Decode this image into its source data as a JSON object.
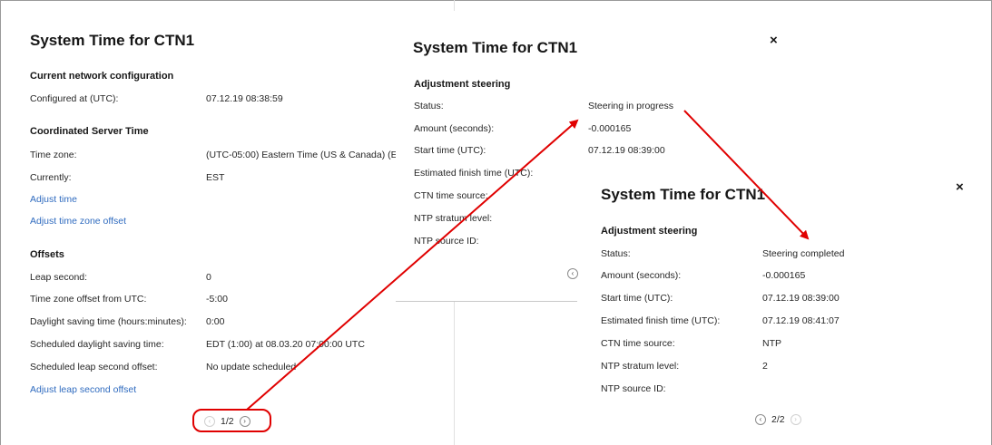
{
  "panel1": {
    "title": "System Time for CTN1",
    "section_network": "Current network configuration",
    "configured_label": "Configured at (UTC):",
    "configured_value": "07.12.19 08:38:59",
    "section_cst": "Coordinated Server Time",
    "timezone_label": "Time zone:",
    "timezone_value": "(UTC-05:00) Eastern Time (US & Canada) (E",
    "currently_label": "Currently:",
    "currently_value": "EST",
    "link_adjust_time": "Adjust time",
    "link_adjust_tz": "Adjust time zone offset",
    "section_offsets": "Offsets",
    "leap_label": "Leap second:",
    "leap_value": "0",
    "tz_offset_label": "Time zone offset from UTC:",
    "tz_offset_value": "-5:00",
    "dst_label": "Daylight saving time (hours:minutes):",
    "dst_value": "0:00",
    "sched_dst_label": "Scheduled daylight saving time:",
    "sched_dst_value": "EDT (1:00) at 08.03.20 07:00:00 UTC",
    "sched_leap_label": "Scheduled leap second offset:",
    "sched_leap_value": "No update scheduled",
    "link_adjust_leap": "Adjust leap second offset",
    "page": "1/2"
  },
  "panel2": {
    "title": "System Time for CTN1",
    "close": "×",
    "section": "Adjustment steering",
    "status_label": "Status:",
    "status_value": "Steering in progress",
    "amount_label": "Amount (seconds):",
    "amount_value": "-0.000165",
    "start_label": "Start time (UTC):",
    "start_value": "07.12.19 08:39:00",
    "finish_label": "Estimated finish time (UTC):",
    "ctn_label": "CTN time source:",
    "stratum_label": "NTP stratum level:",
    "source_label": "NTP source ID:"
  },
  "panel3": {
    "title": "System Time for CTN1",
    "close": "×",
    "section": "Adjustment steering",
    "status_label": "Status:",
    "status_value": "Steering completed",
    "amount_label": "Amount (seconds):",
    "amount_value": "-0.000165",
    "start_label": "Start time (UTC):",
    "start_value": "07.12.19 08:39:00",
    "finish_label": "Estimated finish time (UTC):",
    "finish_value": "07.12.19 08:41:07",
    "ctn_label": "CTN time source:",
    "ctn_value": "NTP",
    "stratum_label": "NTP stratum level:",
    "stratum_value": "2",
    "source_label": "NTP source ID:",
    "page": "2/2"
  },
  "icons": {
    "prev": "chevron-left-circle-icon",
    "next": "chevron-right-circle-icon",
    "close": "close-icon"
  },
  "colors": {
    "annotation": "#e00000",
    "link": "#2f6bbf"
  }
}
